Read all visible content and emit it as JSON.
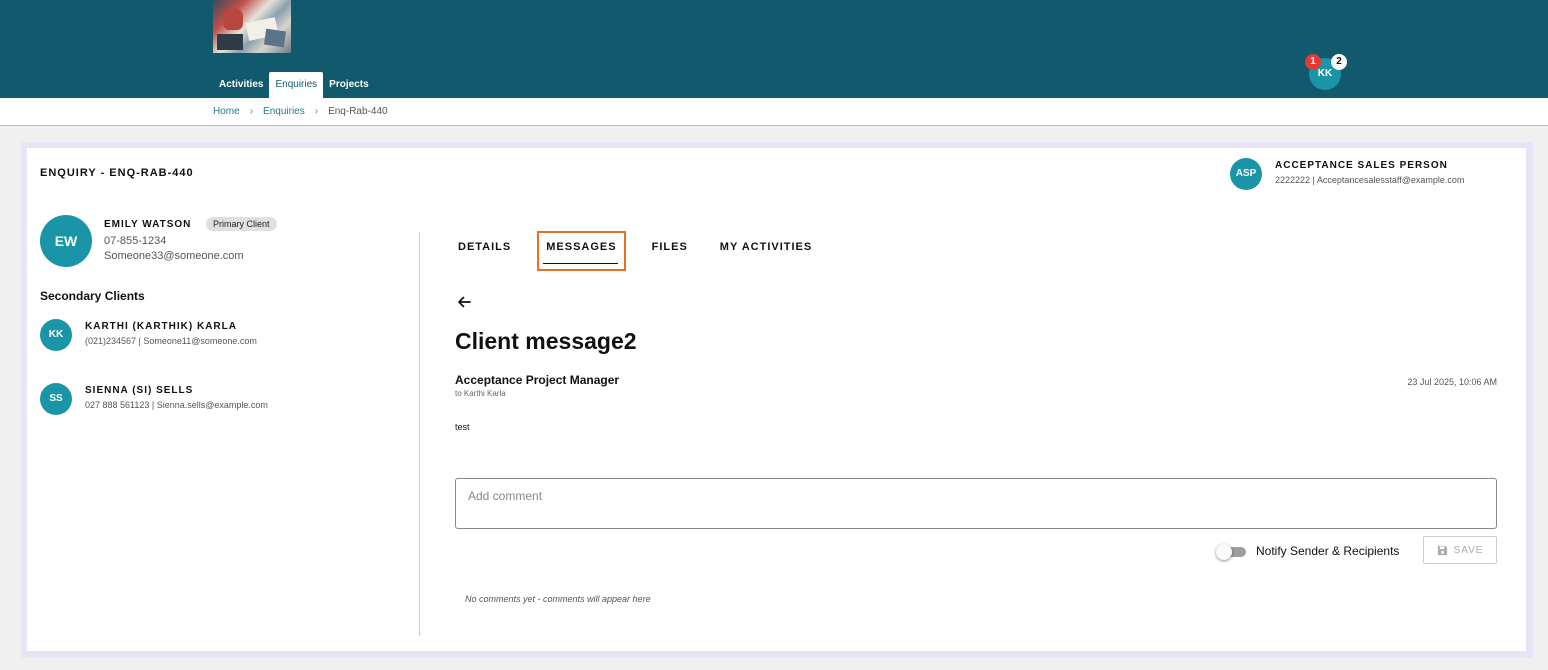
{
  "header": {
    "nav": [
      "Activities",
      "Enquiries",
      "Projects"
    ],
    "active_nav": "Enquiries",
    "user_initials": "KK",
    "badge_red": "1",
    "badge_white": "2"
  },
  "breadcrumb": {
    "home": "Home",
    "enquiries": "Enquiries",
    "current": "Enq-Rab-440"
  },
  "enquiry": {
    "title": "ENQUIRY - ENQ-RAB-440"
  },
  "sales_person": {
    "initials": "ASP",
    "name": "ACCEPTANCE SALES PERSON",
    "meta": "2222222  |  Acceptancesalesstaff@example.com"
  },
  "primary_client": {
    "initials": "EW",
    "name": "EMILY WATSON",
    "chip": "Primary Client",
    "phone": "07-855-1234",
    "email": "Someone33@someone.com"
  },
  "secondary": {
    "title": "Secondary Clients",
    "clients": [
      {
        "initials": "KK",
        "name": "KARTHI (KARTHIK) KARLA",
        "meta": "(021)234567  |  Someone11@someone.com"
      },
      {
        "initials": "SS",
        "name": "SIENNA (SI) SELLS",
        "meta": "027 888 561123  |  Sienna.sells@example.com"
      }
    ]
  },
  "tabs": [
    "DETAILS",
    "MESSAGES",
    "FILES",
    "MY ACTIVITIES"
  ],
  "active_tab": "MESSAGES",
  "message": {
    "title": "Client message2",
    "sender": "Acceptance Project Manager",
    "to": "to Karthi Karla",
    "date": "23 Jul 2025, 10:06 AM",
    "body": "test"
  },
  "comment": {
    "placeholder": "Add comment",
    "notify_label": "Notify Sender & Recipients",
    "notify_on": false,
    "save_label": "SAVE",
    "empty_text": "No comments yet - comments will appear here"
  },
  "colors": {
    "header_bg": "#115a6e",
    "avatar": "#1a95a8",
    "tab_highlight": "#e8702a",
    "badge_red": "#e53935"
  }
}
